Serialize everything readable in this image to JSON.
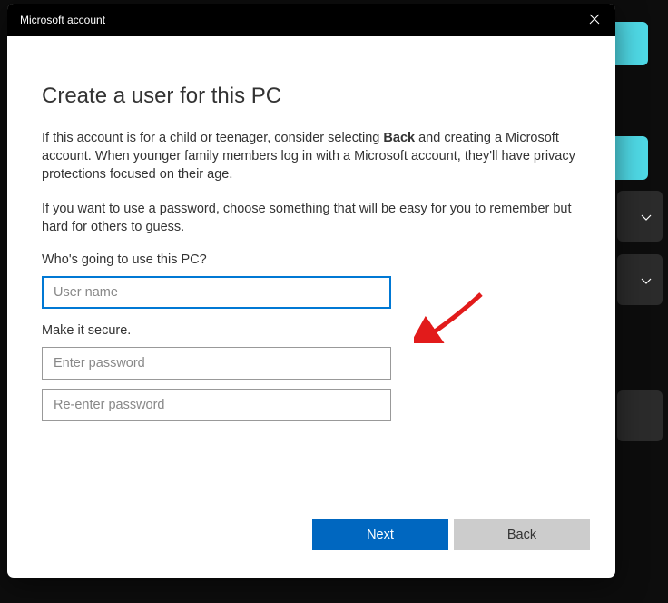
{
  "background": {
    "tiles_color": "#4fd9e6",
    "panel_color": "#2b2b2b"
  },
  "dialog": {
    "title": "Microsoft account",
    "heading": "Create a user for this PC",
    "para1_pre": "If this account is for a child or teenager, consider selecting ",
    "para1_bold": "Back",
    "para1_post": " and creating a Microsoft account. When younger family members log in with a Microsoft account, they'll have privacy protections focused on their age.",
    "para2": "If you want to use a password, choose something that will be easy for you to remember but hard for others to guess.",
    "who_label": "Who's going to use this PC?",
    "username_placeholder": "User name",
    "username_value": "",
    "secure_label": "Make it secure.",
    "password_placeholder": "Enter password",
    "password_value": "",
    "repassword_placeholder": "Re-enter password",
    "repassword_value": "",
    "next_label": "Next",
    "back_label": "Back"
  },
  "colors": {
    "primary": "#0067c0",
    "focus": "#0078d4",
    "arrow": "#e21b1b"
  }
}
